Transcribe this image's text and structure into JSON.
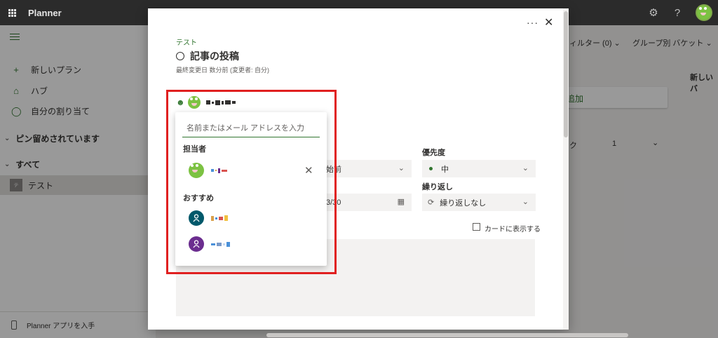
{
  "topbar": {
    "app_title": "Planner"
  },
  "sidebar": {
    "items": [
      {
        "label": "新しいプラン",
        "icon": "plus-icon"
      },
      {
        "label": "ハブ",
        "icon": "home-icon"
      },
      {
        "label": "自分の割り当て",
        "icon": "person-icon"
      }
    ],
    "pinned_label": "ピン留めされています",
    "all_label": "すべて",
    "plan": {
      "badge": "テ",
      "name": "テスト"
    },
    "footer_label": "Planner アプリを入手"
  },
  "board": {
    "filter_label": "ィルター (0)",
    "group_label": "グループ別 バケット",
    "new_bucket_label": "新しいバ",
    "add_task_label": "追加",
    "fragment_ku": "ク",
    "fragment_count": "1"
  },
  "task": {
    "bucket": "テスト",
    "title": "記事の投稿",
    "modified": "最終変更日 数分前 (変更者: 自分)"
  },
  "fields": {
    "progress_fragment": "始前",
    "date_fragment": "3/30",
    "priority_label": "優先度",
    "priority_value": "中",
    "repeat_label": "繰り返し",
    "repeat_value": "繰り返しなし",
    "show_on_card": "カードに表示する"
  },
  "picker": {
    "placeholder": "名前またはメール アドレスを入力",
    "assigned_header": "担当者",
    "suggested_header": "おすすめ",
    "suggestion_colors": [
      "#00596b",
      "#6b2d8f"
    ]
  }
}
